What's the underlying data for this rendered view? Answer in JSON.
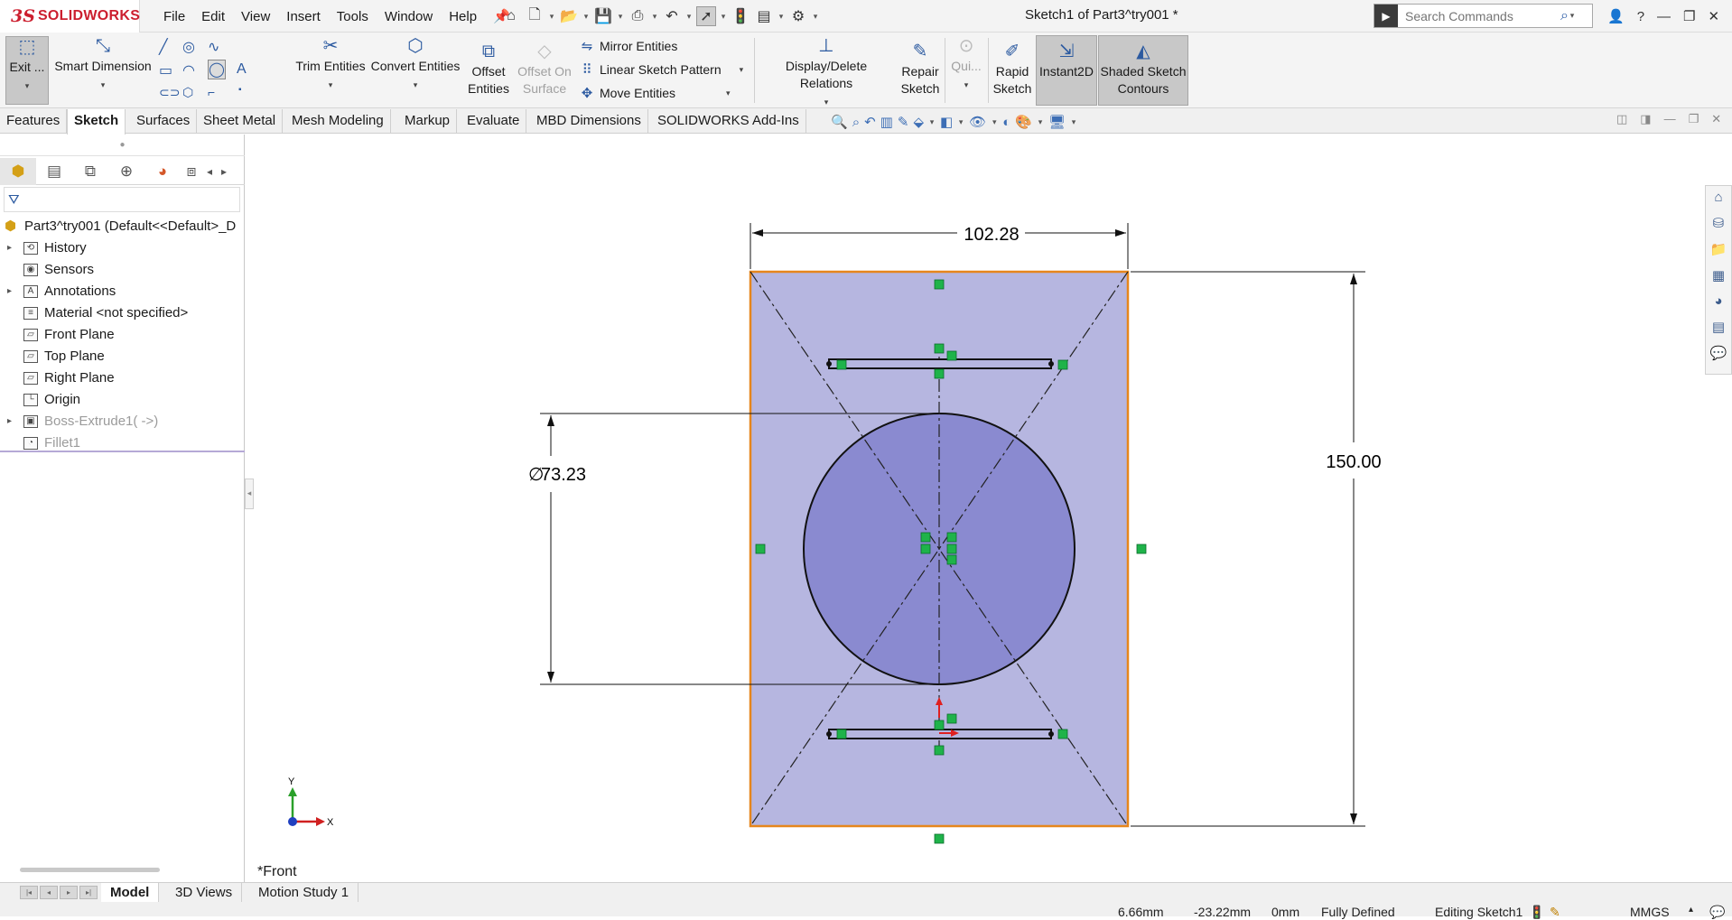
{
  "app": {
    "logo_ds": "3S",
    "logo_text": "SOLIDWORKS",
    "document_title": "Sketch1 of Part3^try001 *"
  },
  "menu": [
    "File",
    "Edit",
    "View",
    "Insert",
    "Tools",
    "Window",
    "Help"
  ],
  "search": {
    "placeholder": "Search Commands"
  },
  "command_manager": {
    "exit_sketch": "Exit ...",
    "smart_dimension": "Smart Dimension",
    "trim_entities": "Trim Entities",
    "convert_entities": "Convert Entities",
    "offset_entities": "Offset Entities",
    "offset_on_surface": "Offset On Surface",
    "mirror_entities": "Mirror Entities",
    "linear_sketch_pattern": "Linear Sketch Pattern",
    "move_entities": "Move Entities",
    "display_delete_relations": "Display/Delete Relations",
    "repair_sketch": "Repair Sketch",
    "quick_snaps": "Qui...",
    "rapid_sketch": "Rapid Sketch",
    "instant2d": "Instant2D",
    "shaded_sketch_contours": "Shaded Sketch Contours"
  },
  "tabs": [
    "Features",
    "Sketch",
    "Surfaces",
    "Sheet Metal",
    "Mesh Modeling",
    "Markup",
    "Evaluate",
    "MBD Dimensions",
    "SOLIDWORKS Add-Ins"
  ],
  "active_tab": "Sketch",
  "feature_tree": {
    "root": "Part3^try001  (Default<<Default>_D",
    "items": [
      {
        "label": "History",
        "icon": "history-icon",
        "expandable": true
      },
      {
        "label": "Sensors",
        "icon": "sensors-icon",
        "expandable": false
      },
      {
        "label": "Annotations",
        "icon": "annotations-icon",
        "expandable": true
      },
      {
        "label": "Material <not specified>",
        "icon": "material-icon",
        "expandable": false
      },
      {
        "label": "Front Plane",
        "icon": "plane-icon",
        "expandable": false
      },
      {
        "label": "Top Plane",
        "icon": "plane-icon",
        "expandable": false
      },
      {
        "label": "Right Plane",
        "icon": "plane-icon",
        "expandable": false
      },
      {
        "label": "Origin",
        "icon": "origin-icon",
        "expandable": false
      },
      {
        "label": "Boss-Extrude1( ->)",
        "icon": "extrude-icon",
        "expandable": true,
        "suppressed": true
      },
      {
        "label": "Fillet1",
        "icon": "fillet-icon",
        "expandable": false,
        "suppressed": true
      }
    ]
  },
  "sketch": {
    "width_dim": "102.28",
    "height_dim": "150.00",
    "diameter_dim": "73.23",
    "diameter_symbol": "∅",
    "triad_x": "X",
    "triad_y": "Y",
    "view_label": "*Front"
  },
  "bottom_tabs": [
    "Model",
    "3D Views",
    "Motion Study 1"
  ],
  "active_bottom_tab": "Model",
  "status": {
    "x": "6.66mm",
    "y": "-23.22mm",
    "z": "0mm",
    "definition": "Fully Defined",
    "mode": "Editing Sketch1",
    "units": "MMGS"
  },
  "colors": {
    "accent": "#2c5aa0",
    "brand": "#cc1f2f",
    "sketch_fill": "#b6b6e0",
    "circle_fill": "#8a8ad0",
    "outline": "#e6861c",
    "relation_green": "#1fb34a"
  }
}
